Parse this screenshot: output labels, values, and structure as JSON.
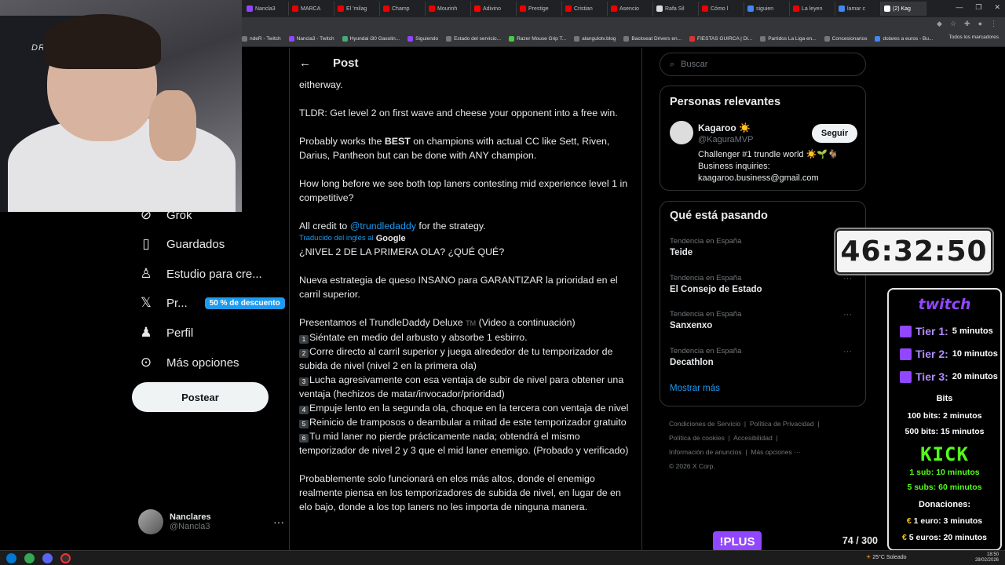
{
  "browser": {
    "tabs": [
      "Nancla3",
      "MARCA",
      "El 'milag",
      "Champ",
      "Mourinh",
      "Adivino",
      "Prestige",
      "Cristian",
      "Asencio",
      "Rafa Sil",
      "Cómo l",
      "siguien",
      "La leyen",
      "lamar c",
      "(2) Kag"
    ],
    "bookmarks": [
      "ndeR - Twitch",
      "Nancla3 - Twitch",
      "Hyundai i30 Gasolin...",
      "Siguiendo",
      "Estado del servicio...",
      "Razer Mouse Grip T...",
      "alangulotv.blog",
      "Backseat Drivers en...",
      "FIESTAS GUIRCA | Di...",
      "Partidos La Liga en...",
      "Concesionarios",
      "dolares a euros - Bu..."
    ],
    "bookmarks_right": "Todos los marcadores"
  },
  "webcam": {
    "chair_text": "DRIFT"
  },
  "nav": {
    "items": [
      {
        "label": "Grok",
        "icon": "grok-icon"
      },
      {
        "label": "Guardados",
        "icon": "bookmark-icon"
      },
      {
        "label": "Estudio para cre...",
        "icon": "creator-studio-icon"
      },
      {
        "label": "Pr...",
        "icon": "x-premium-icon",
        "badge": "50 % de descuento"
      },
      {
        "label": "Perfil",
        "icon": "profile-icon"
      },
      {
        "label": "Más opciones",
        "icon": "more-circle-icon"
      }
    ],
    "post_button": "Postear",
    "account": {
      "name": "Nanclares",
      "handle": "@Nancla3",
      "more": "···"
    }
  },
  "post": {
    "header_title": "Post",
    "paragraphs": {
      "p0": "eitherway.",
      "p1": "TLDR: Get level 2 on first wave and cheese your opponent into a free win.",
      "p2a": "Probably works the ",
      "p2b": "BEST",
      "p2c": " on champions with actual CC like Sett, Riven, Darius, Pantheon but can be done with ANY champion.",
      "p3": "How long before we see both top laners contesting mid experience level 1 in competitive?",
      "p4a": "All credit to ",
      "p4link": "@trundledaddy",
      "p4b": " for the strategy.",
      "translated": "Traducido del inglés al",
      "google": "Google",
      "p5": "¿NIVEL 2 DE LA PRIMERA OLA? ¿QUÉ QUÉ?",
      "p6": "Nueva estrategia de queso INSANO para GARANTIZAR la prioridad en el carril superior.",
      "p7a": "Presentamos el TrundleDaddy Deluxe ",
      "p7tm": "TM",
      "p7b": " (Video a continuación)",
      "l1": "Siéntate en medio del arbusto y absorbe 1 esbirro.",
      "l2": "Corre directo al carril superior y juega alrededor de tu temporizador de subida de nivel (nivel 2 en la primera ola)",
      "l3": "Lucha agresivamente con esa ventaja de subir de nivel para obtener una ventaja (hechizos de matar/invocador/prioridad)",
      "l4": "Empuje lento en la segunda ola, choque en la tercera con ventaja de nivel",
      "l5": "Reinicio de tramposos o deambular a mitad de este temporizador gratuito",
      "l6": "Tu mid laner no pierde prácticamente nada; obtendrá el mismo temporizador de nivel 2 y 3 que el mid laner enemigo. (Probado y verificado)",
      "p8": "Probablemente solo funcionará en elos más altos, donde el enemigo realmente piensa en los temporizadores de subida de nivel, en lugar de en elo bajo, donde a los top laners no les importa de ninguna manera."
    },
    "list_numbers": [
      "1",
      "2",
      "3",
      "4",
      "5",
      "6"
    ]
  },
  "sidebar": {
    "search_placeholder": "Buscar",
    "relevant_title": "Personas relevantes",
    "relevant": {
      "name": "Kagaroo ☀️",
      "handle": "@KaguraMVP",
      "follow": "Seguir",
      "bio": "Challenger #1 trundle world ☀️🌱🐐 Business inquiries: kaagaroo.business@gmail.com"
    },
    "trends_title": "Qué está pasando",
    "trends": [
      {
        "context": "Tendencia en España",
        "name": "Teide"
      },
      {
        "context": "Tendencia en España",
        "name": "El Consejo de Estado"
      },
      {
        "context": "Tendencia en España",
        "name": "Sanxenxo"
      },
      {
        "context": "Tendencia en España",
        "name": "Decathlon"
      }
    ],
    "trend_more": "···",
    "show_more": "Mostrar más",
    "footer": [
      "Condiciones de Servicio",
      "Política de Privacidad",
      "Política de cookies",
      "Accesibilidad",
      "Información de anuncios",
      "Más opciones ···",
      "© 2026 X Corp."
    ]
  },
  "overlay": {
    "timer": "46:32:50",
    "twitch_logo": "twitch",
    "tiers": [
      {
        "label": "Tier 1:",
        "value": "5 minutos"
      },
      {
        "label": "Tier 2:",
        "value": "10 minutos"
      },
      {
        "label": "Tier 3:",
        "value": "20 minutos"
      }
    ],
    "bits_head": "Bits",
    "bits": [
      "100 bits: 2 minutos",
      "500 bits: 15 minutos"
    ],
    "kick_logo": "KICK",
    "kick": [
      "1 sub: 10 minutos",
      "5 subs: 60 minutos"
    ],
    "donations_head": "Donaciones:",
    "donations": [
      "1 euro: 3 minutos",
      "5 euros: 20 minutos"
    ],
    "chat_command": "!PLUS",
    "chat_count": "74 / 300"
  },
  "taskbar": {
    "weather": "25°C Soleado",
    "time": "18:50",
    "date": "28/02/2026"
  }
}
